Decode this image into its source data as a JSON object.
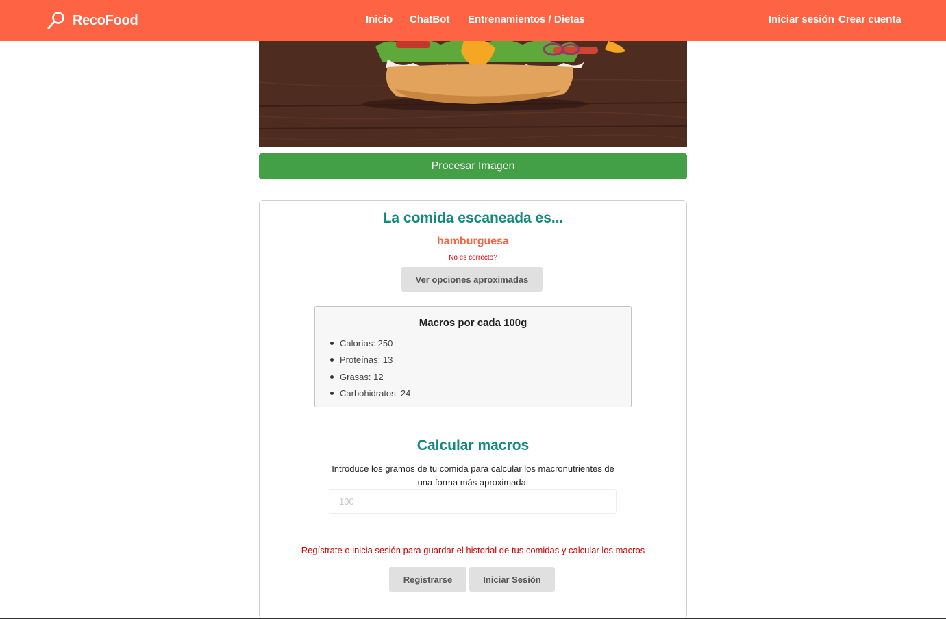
{
  "brand": {
    "name": "RecoFood",
    "icon": "magnifier-icon",
    "navbar_color": "#fe6443"
  },
  "nav": {
    "links": [
      "Inicio",
      "ChatBot",
      "Entrenamientos / Dietas"
    ],
    "login": "Iniciar sesión",
    "signup": "Crear cuenta"
  },
  "hero": {
    "image": "burger-photo"
  },
  "process": {
    "label": "Procesar Imagen",
    "color": "#43a047"
  },
  "result": {
    "title": "La comida escaneada es...",
    "food": "hamburguesa",
    "not_correct": "No es correcto?",
    "options_label": "Ver opciones aproximadas",
    "title_color": "#13897f",
    "food_color": "#fe6443"
  },
  "macros": {
    "title": "Macros por cada 100g",
    "items": [
      "Calorías: 250",
      "Proteínas: 13",
      "Grasas: 12",
      "Carbohidratos: 24"
    ]
  },
  "calculator": {
    "title": "Calcular macros",
    "description": "Introduce los gramos de tu comida para calcular los macronutrientes de una forma más aproximada:",
    "input_placeholder": "100",
    "register_message": "Regístrate o inicia sesión para guardar el historial de tus comidas y calcular los macros",
    "register_label": "Registrarse",
    "login_label": "Iniciar Sesión",
    "message_color": "#d50000"
  }
}
